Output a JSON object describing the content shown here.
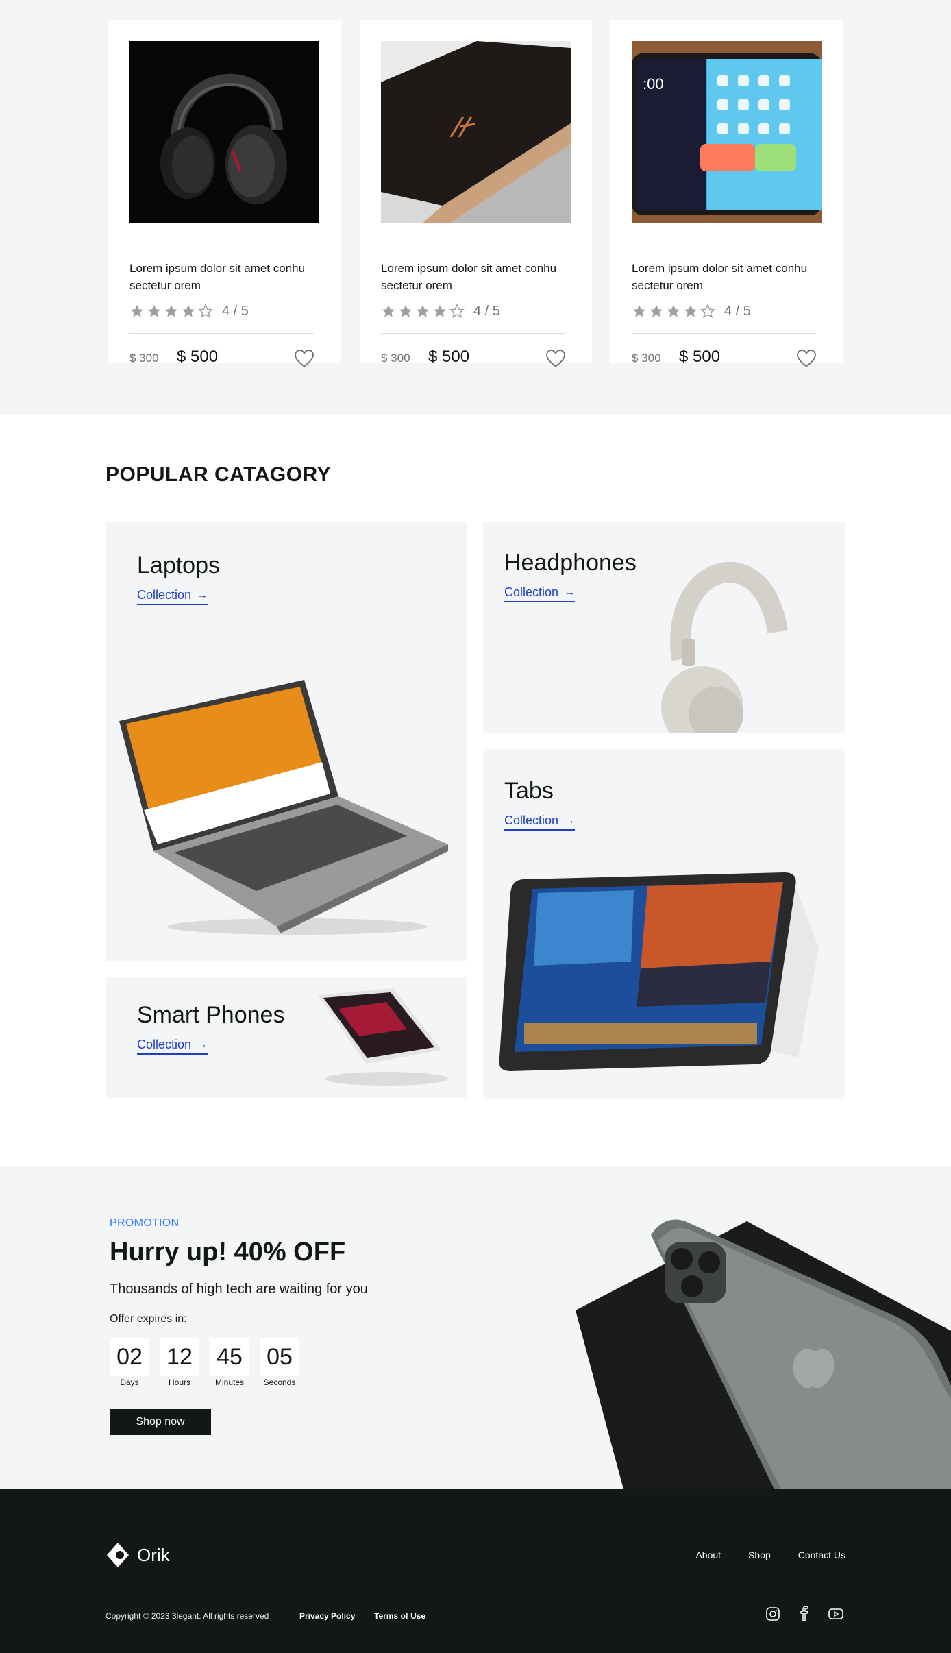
{
  "products": [
    {
      "title": "Lorem ipsum dolor sit amet conhu sectetur orem",
      "rating_text": "4 / 5",
      "rating": 4,
      "old_price": "$ 300",
      "new_price": "$ 500",
      "image": "headphones-black"
    },
    {
      "title": "Lorem ipsum dolor sit amet conhu sectetur orem",
      "rating_text": "4 / 5",
      "rating": 4,
      "old_price": "$ 300",
      "new_price": "$ 500",
      "image": "laptop-black"
    },
    {
      "title": "Lorem ipsum dolor sit amet conhu sectetur orem",
      "rating_text": "4 / 5",
      "rating": 4,
      "old_price": "$ 300",
      "new_price": "$ 500",
      "image": "tablet-colorful"
    }
  ],
  "category": {
    "title": "POPULAR CATAGORY",
    "tiles": [
      {
        "name": "Laptops",
        "link": "Collection"
      },
      {
        "name": "Headphones",
        "link": "Collection"
      },
      {
        "name": "Tabs",
        "link": "Collection"
      },
      {
        "name": "Smart Phones",
        "link": "Collection"
      }
    ]
  },
  "promotion": {
    "label": "PROMOTION",
    "title": "Hurry up! 40% OFF",
    "subtitle": "Thousands of high tech are waiting for you",
    "expires_label": "Offer expires in:",
    "countdown": [
      {
        "value": "02",
        "unit": "Days"
      },
      {
        "value": "12",
        "unit": "Hours"
      },
      {
        "value": "45",
        "unit": "Minutes"
      },
      {
        "value": "05",
        "unit": "Seconds"
      }
    ],
    "button": "Shop now"
  },
  "footer": {
    "brand": "Orik",
    "nav": [
      "About",
      "Shop",
      "Contact Us"
    ],
    "copyright": "Copyright © 2023 3legant. All rights reserved",
    "privacy": "Privacy Policy",
    "terms": "Terms of Use",
    "social_icons": [
      "instagram-icon",
      "facebook-icon",
      "youtube-icon"
    ]
  },
  "colors": {
    "background_light": "#f3f5f7",
    "text_dark": "#141718",
    "link_blue": "#1f3fc4",
    "promo_blue": "#377dff",
    "footer_bg": "#141718"
  }
}
